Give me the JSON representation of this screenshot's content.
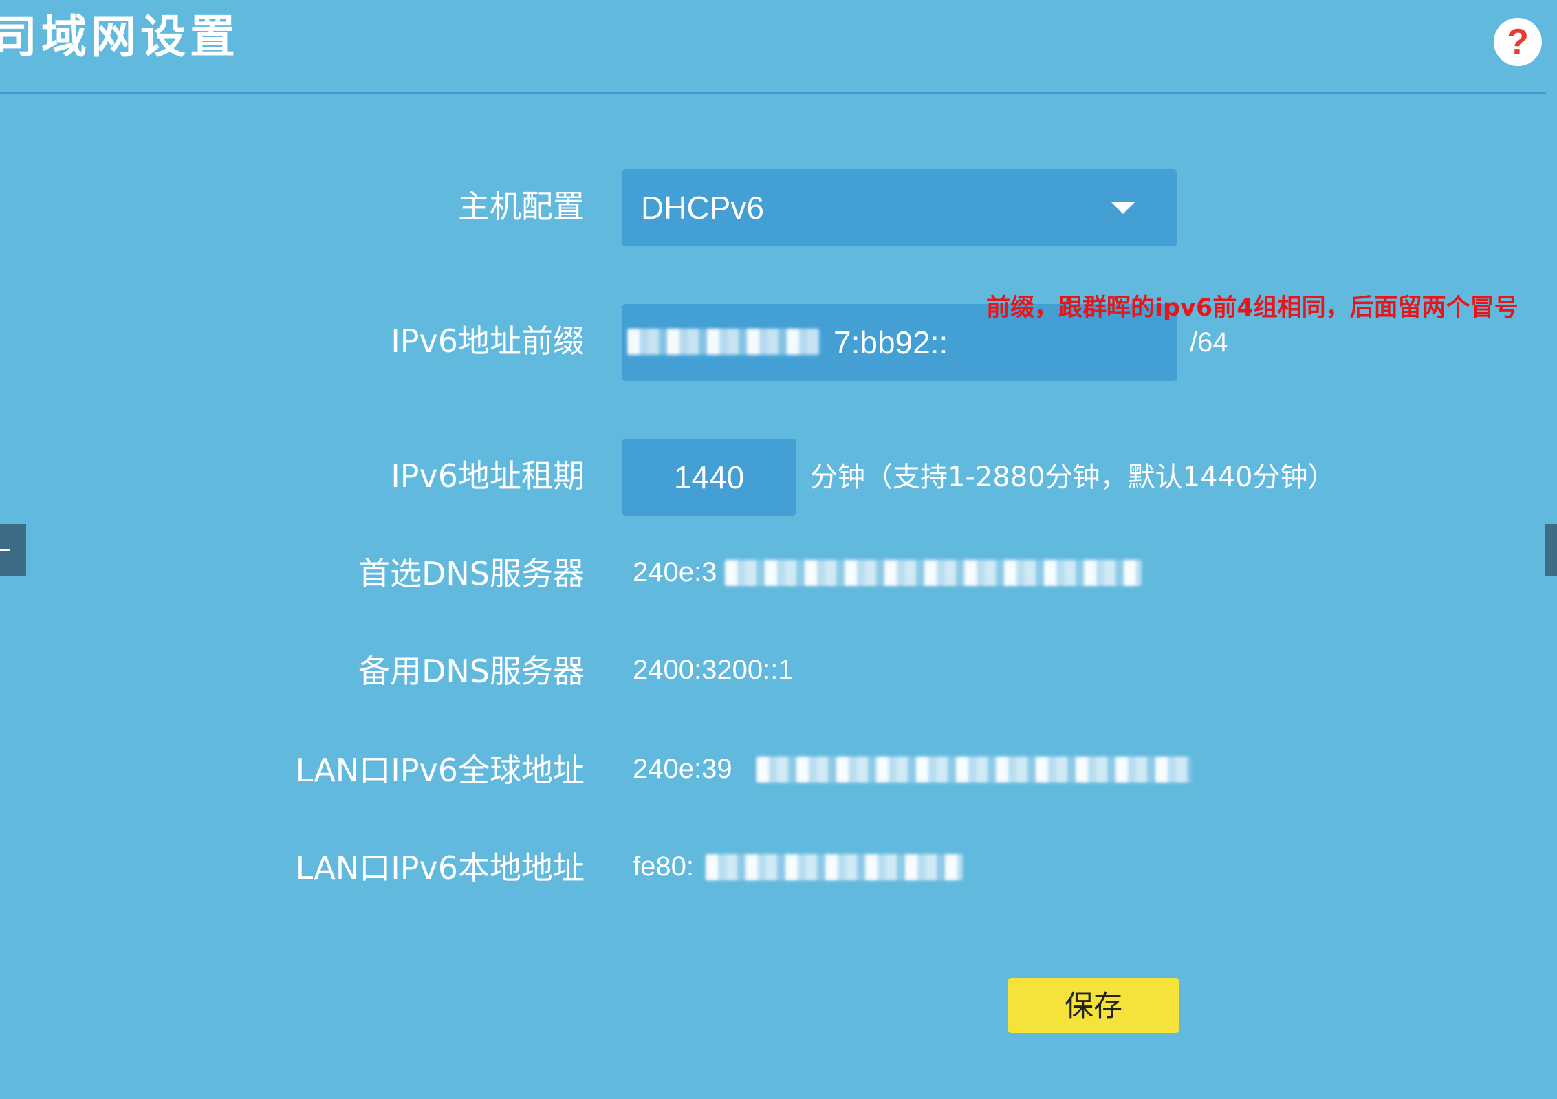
{
  "page": {
    "title": "司域网设置"
  },
  "help_icon": "?",
  "form": {
    "host_config": {
      "label": "主机配置",
      "selected": "DHCPv6"
    },
    "prefix": {
      "label": "IPv6地址前缀",
      "value_visible": "7:bb92::",
      "suffix": "/64",
      "annotation": "前缀，跟群晖的ipv6前4组相同，后面留两个冒号"
    },
    "lease": {
      "label": "IPv6地址租期",
      "value": "1440",
      "hint": "分钟（支持1-2880分钟，默认1440分钟）"
    },
    "primary_dns": {
      "label": "首选DNS服务器",
      "value_visible": "240e:3"
    },
    "secondary_dns": {
      "label": "备用DNS服务器",
      "value": "2400:3200::1"
    },
    "lan_global": {
      "label": "LAN口IPv6全球地址",
      "value_visible": "240e:39"
    },
    "lan_local": {
      "label": "LAN口IPv6本地地址",
      "value_visible": "fe80:"
    },
    "save_label": "保存"
  },
  "colors": {
    "background": "#62b9de",
    "input_fill": "#449fd5",
    "divider": "#3f9bd6",
    "save_button": "#f5e33b",
    "annotation": "#e8161b"
  }
}
